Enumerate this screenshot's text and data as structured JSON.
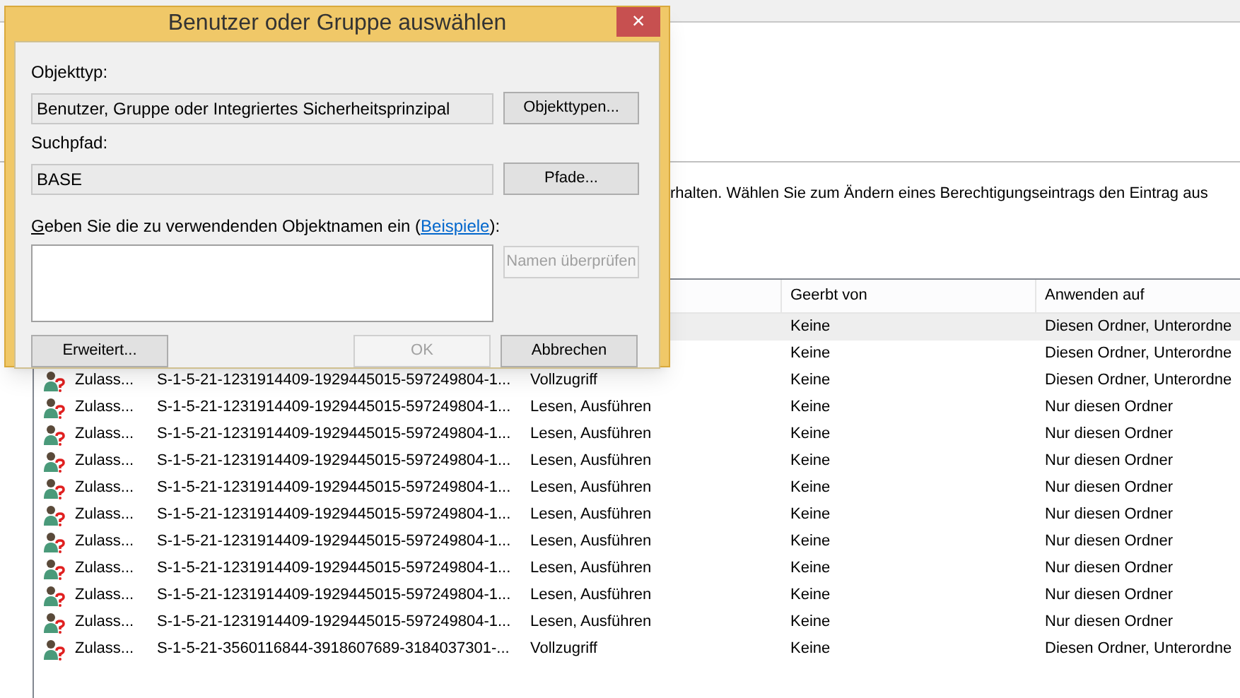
{
  "background_window": {
    "description": "rhalten. Wählen Sie zum Ändern eines Berechtigungseintrags den Eintrag aus",
    "table": {
      "columns": [
        "Geerbt von",
        "Anwenden auf"
      ],
      "rows": [
        {
          "selected": true,
          "inherited_from": "Keine",
          "applies_to": "Diesen Ordner, Unterordne"
        },
        {
          "selected": false,
          "inherited_from": "Keine",
          "applies_to": "Diesen Ordner, Unterordne"
        },
        {
          "selected": false,
          "name": "Zulass...",
          "sid": "S-1-5-21-1231914409-1929445015-597249804-1...",
          "permission": "Vollzugriff",
          "inherited_from": "Keine",
          "applies_to": "Diesen Ordner, Unterordne"
        },
        {
          "selected": false,
          "name": "Zulass...",
          "sid": "S-1-5-21-1231914409-1929445015-597249804-1...",
          "permission": "Lesen, Ausführen",
          "inherited_from": "Keine",
          "applies_to": "Nur diesen Ordner"
        },
        {
          "selected": false,
          "name": "Zulass...",
          "sid": "S-1-5-21-1231914409-1929445015-597249804-1...",
          "permission": "Lesen, Ausführen",
          "inherited_from": "Keine",
          "applies_to": "Nur diesen Ordner"
        },
        {
          "selected": false,
          "name": "Zulass...",
          "sid": "S-1-5-21-1231914409-1929445015-597249804-1...",
          "permission": "Lesen, Ausführen",
          "inherited_from": "Keine",
          "applies_to": "Nur diesen Ordner"
        },
        {
          "selected": false,
          "name": "Zulass...",
          "sid": "S-1-5-21-1231914409-1929445015-597249804-1...",
          "permission": "Lesen, Ausführen",
          "inherited_from": "Keine",
          "applies_to": "Nur diesen Ordner"
        },
        {
          "selected": false,
          "name": "Zulass...",
          "sid": "S-1-5-21-1231914409-1929445015-597249804-1...",
          "permission": "Lesen, Ausführen",
          "inherited_from": "Keine",
          "applies_to": "Nur diesen Ordner"
        },
        {
          "selected": false,
          "name": "Zulass...",
          "sid": "S-1-5-21-1231914409-1929445015-597249804-1...",
          "permission": "Lesen, Ausführen",
          "inherited_from": "Keine",
          "applies_to": "Nur diesen Ordner"
        },
        {
          "selected": false,
          "name": "Zulass...",
          "sid": "S-1-5-21-1231914409-1929445015-597249804-1...",
          "permission": "Lesen, Ausführen",
          "inherited_from": "Keine",
          "applies_to": "Nur diesen Ordner"
        },
        {
          "selected": false,
          "name": "Zulass...",
          "sid": "S-1-5-21-1231914409-1929445015-597249804-1...",
          "permission": "Lesen, Ausführen",
          "inherited_from": "Keine",
          "applies_to": "Nur diesen Ordner"
        },
        {
          "selected": false,
          "name": "Zulass...",
          "sid": "S-1-5-21-1231914409-1929445015-597249804-1...",
          "permission": "Lesen, Ausführen",
          "inherited_from": "Keine",
          "applies_to": "Nur diesen Ordner"
        },
        {
          "selected": false,
          "name": "Zulass...",
          "sid": "S-1-5-21-3560116844-3918607689-3184037301-...",
          "permission": "Vollzugriff",
          "inherited_from": "Keine",
          "applies_to": "Diesen Ordner, Unterordne"
        }
      ]
    }
  },
  "dialog": {
    "title": "Benutzer oder Gruppe auswählen",
    "close": "×",
    "object_type_label": "Objekttyp:",
    "object_type_value": "Benutzer, Gruppe oder Integriertes Sicherheitsprinzipal",
    "object_types_button": "Objekttypen...",
    "search_path_label": "Suchpfad:",
    "search_path_value": "BASE",
    "paths_button": "Pfade...",
    "names_label_access_key": "G",
    "names_label_before": "eben Sie die zu verwendenden Objektnamen ein (",
    "names_label_link": "Beispiele",
    "names_label_after": "):",
    "check_names_button": {
      "label": "Namen überprüfen",
      "disabled": true
    },
    "buttons": [
      {
        "label": "Erweitert...",
        "disabled": false
      },
      {
        "label": "OK",
        "disabled": true
      },
      {
        "label": "Abbrechen",
        "disabled": false
      }
    ]
  }
}
